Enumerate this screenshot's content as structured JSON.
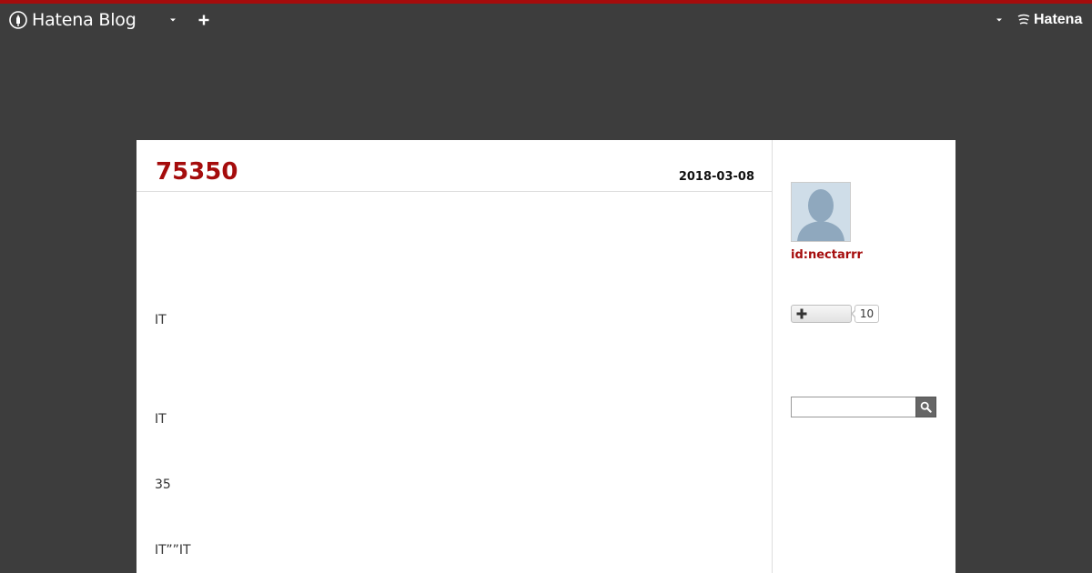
{
  "global_header": {
    "logo_text": "Hatena Blog",
    "hatena_text": "Hatena"
  },
  "entry": {
    "title": "75350",
    "date": "2018-03-08",
    "lines": [
      "IT",
      "IT",
      "35",
      "IT””IT"
    ]
  },
  "sidebar": {
    "profile_id": "id:nectarrr",
    "follow_count": "10",
    "search_placeholder": ""
  },
  "colors": {
    "accent": "#a50c0c",
    "page_background": "#3d3d3d",
    "content_background": "#ffffff"
  },
  "icons": {
    "logo": "hatena-blog-pen-icon",
    "menu": "caret-down-icon",
    "write": "plus-icon",
    "hatena": "hatena-logo-icon",
    "follow": "plus-icon",
    "search": "magnifier-icon",
    "avatar": "default-avatar-silhouette"
  }
}
